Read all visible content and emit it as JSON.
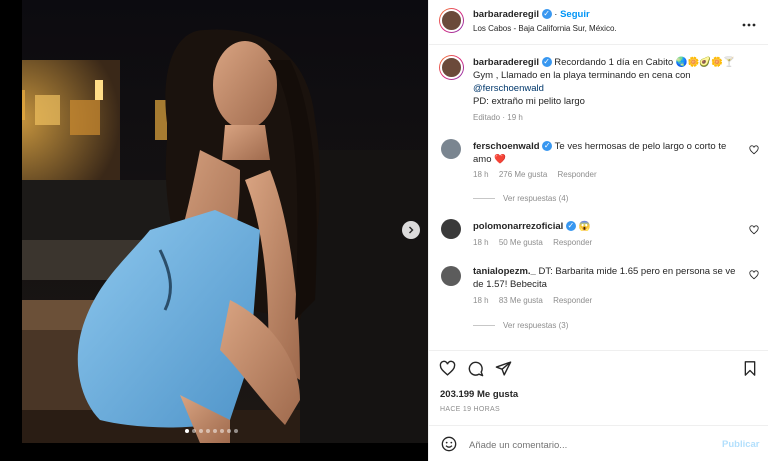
{
  "post": {
    "username": "barbaraderegil",
    "follow_label": "Seguir",
    "location": "Los Cabos - Baja California Sur, México.",
    "caption_line1": "Recordando 1 día en Cabito",
    "caption_emojis": "🌏🌼🥑🌼🍸",
    "caption_line2": "Gym , Llamado en la playa terminando en cena con",
    "caption_mention": "@ferschoenwald",
    "caption_line3": "PD: extraño mi pelito largo",
    "caption_meta": "Editado · 19 h",
    "likes": "203.199 Me gusta",
    "time_ago": "HACE 19 HORAS",
    "comment_placeholder": "Añade un comentario...",
    "publish_label": "Publicar",
    "carousel_total": 8,
    "carousel_active": 0
  },
  "comments": [
    {
      "username": "ferschoenwald",
      "verified": true,
      "text": "Te ves hermosas de pelo largo o corto te amo",
      "emoji": "❤️",
      "time": "18 h",
      "likes": "276 Me gusta",
      "reply": "Responder",
      "view_replies": "Ver respuestas (4)"
    },
    {
      "username": "polomonarrezoficial",
      "verified": true,
      "text": "",
      "emoji": "😱",
      "time": "18 h",
      "likes": "50 Me gusta",
      "reply": "Responder"
    },
    {
      "username": "tanialopezm._",
      "verified": false,
      "text": "DT: Barbarita mide 1.65 pero en persona se ve de 1.57! Bebecita",
      "emoji": "",
      "time": "18 h",
      "likes": "83 Me gusta",
      "reply": "Responder",
      "view_replies": "Ver respuestas (3)"
    }
  ],
  "icons": {
    "more": "more-icon",
    "like": "heart-icon",
    "comment": "comment-icon",
    "share": "send-icon",
    "save": "bookmark-icon",
    "emoji": "emoji-icon",
    "next": "chevron-right-icon"
  },
  "colors": {
    "link": "#0095f6",
    "verified": "#3897f0",
    "muted": "#8e8e8e",
    "heart_red": "#ed4956"
  }
}
